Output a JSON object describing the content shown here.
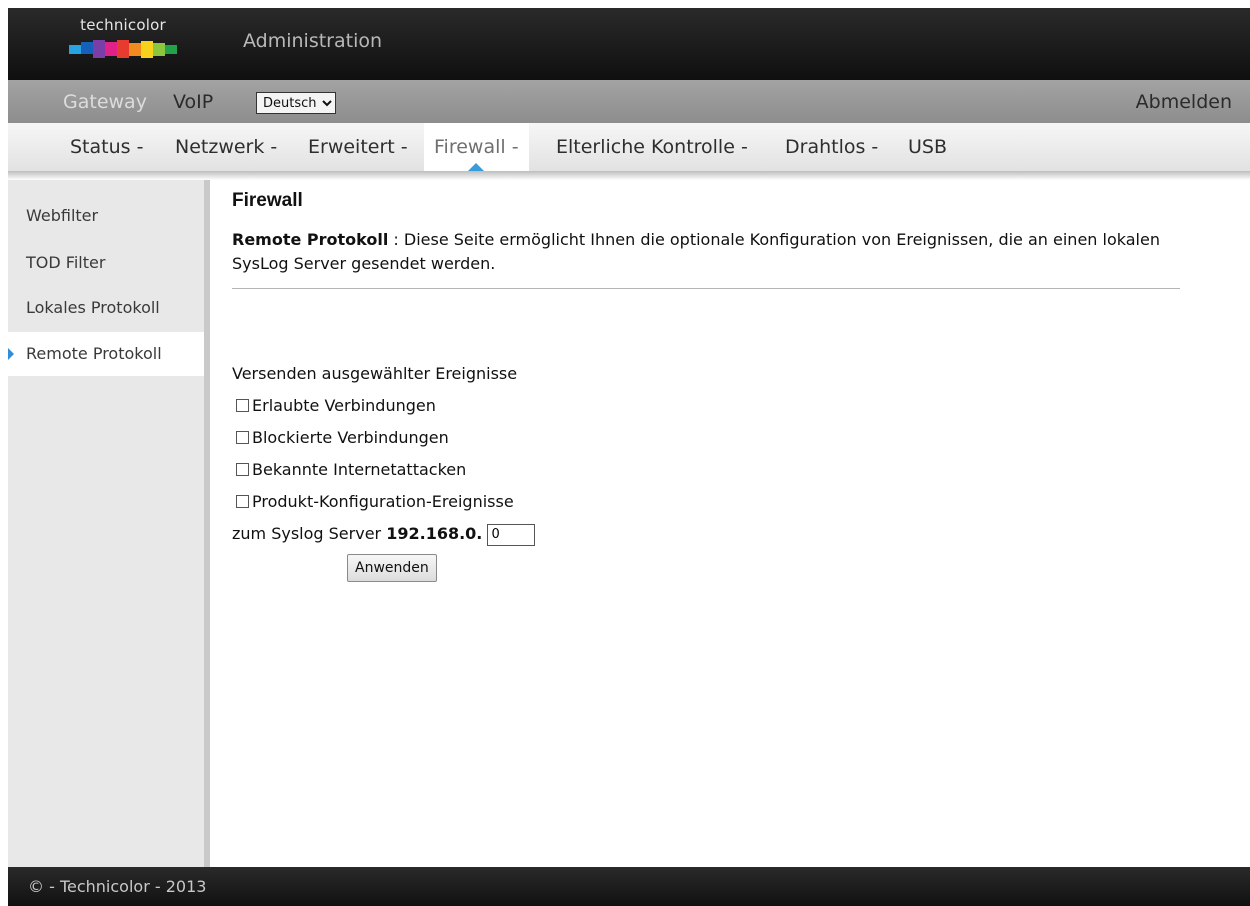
{
  "header": {
    "logo_text": "technicolor",
    "title": "Administration"
  },
  "topnav": {
    "gateway": "Gateway",
    "voip": "VoIP",
    "language_selected": "Deutsch",
    "logout": "Abmelden"
  },
  "mainnav": {
    "status": "Status -",
    "netzwerk": "Netzwerk -",
    "erweitert": "Erweitert -",
    "firewall": "Firewall -",
    "elterliche": "Elterliche Kontrolle -",
    "drahtlos": "Drahtlos -",
    "usb": "USB",
    "active": "Firewall -"
  },
  "sidebar": {
    "items": [
      {
        "label": "Webfilter"
      },
      {
        "label": "TOD Filter"
      },
      {
        "label": "Lokales Protokoll"
      },
      {
        "label": "Remote Protokoll",
        "active": true
      }
    ]
  },
  "content": {
    "title": "Firewall",
    "desc_label": "Remote Protokoll",
    "desc_sep": " : ",
    "desc_text": "Diese Seite ermöglicht Ihnen die optionale Konfiguration von Ereignissen, die an einen lokalen SysLog Server gesendet werden.",
    "section_label": "Versenden ausgewählter Ereignisse",
    "checkboxes": [
      {
        "label": "Erlaubte Verbindungen",
        "checked": false
      },
      {
        "label": "Blockierte Verbindungen",
        "checked": false
      },
      {
        "label": "Bekannte Internetattacken",
        "checked": false
      },
      {
        "label": "Produkt-Konfiguration-Ereignisse",
        "checked": false
      }
    ],
    "syslog_label": "zum Syslog Server",
    "ip_prefix": "192.168.0.",
    "ip_last_octet": "0",
    "apply_button": "Anwenden"
  },
  "footer": {
    "text": "© - Technicolor - 2013"
  },
  "colors": {
    "active_indicator": "#3a9bd9",
    "header_bg": "#1c1c1c",
    "gateway_bar_bg": "#999999"
  }
}
